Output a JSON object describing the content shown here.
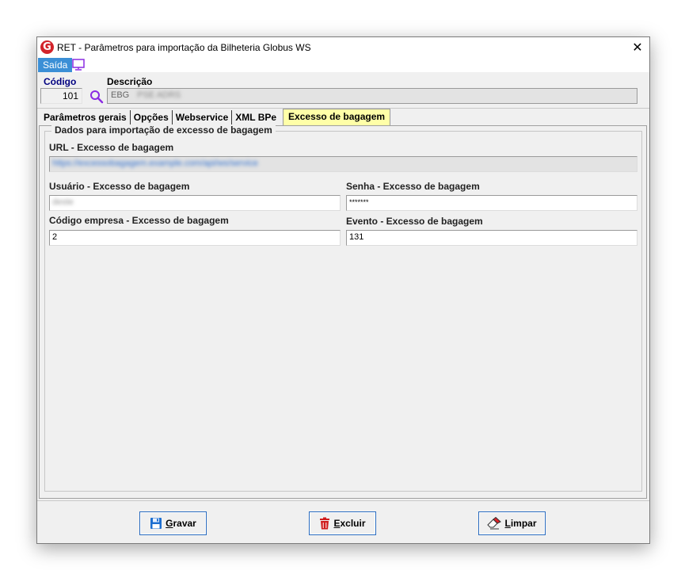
{
  "window": {
    "title": "RET - Parâmetros para importação da Bilheteria Globus WS",
    "logo_letter": "G",
    "close_glyph": "✕"
  },
  "menu": {
    "saida_label": "Saída"
  },
  "header": {
    "codigo_label": "Código",
    "codigo_value": "101",
    "descricao_label": "Descrição",
    "descricao_value": "EBG",
    "descricao_obscured": "PSE ADRS"
  },
  "tabs": [
    {
      "label": "Parâmetros gerais",
      "active": false
    },
    {
      "label": "Opções",
      "active": false
    },
    {
      "label": "Webservice",
      "active": false
    },
    {
      "label": "XML BPe",
      "active": false
    },
    {
      "label": "Excesso de bagagem",
      "active": true
    }
  ],
  "form": {
    "group_title": "Dados para importação de excesso de bagagem",
    "url_label": "URL - Excesso de bagagem",
    "url_value": "https://excessobagagem.example.com/api/ws/service",
    "usuario_label": "Usuário - Excesso de bagagem",
    "usuario_value": "deste",
    "senha_label": "Senha - Excesso de bagagem",
    "senha_value": "*******",
    "codigo_empresa_label": "Código empresa - Excesso de bagagem",
    "codigo_empresa_value": "2",
    "evento_label": "Evento - Excesso de bagagem",
    "evento_value": "131"
  },
  "buttons": {
    "gravar_first": "G",
    "gravar_rest": "ravar",
    "excluir_first": "E",
    "excluir_rest": "xcluir",
    "limpar_first": "L",
    "limpar_rest": "impar"
  },
  "icons": {
    "logo": "globus-logo-icon",
    "monitor": "monitor-icon",
    "search": "search-icon",
    "save": "floppy-disk-icon",
    "delete": "trash-icon",
    "clear": "eraser-icon"
  },
  "colors": {
    "accent": "#3b8fd6",
    "active_tab": "#ffffa8",
    "label_blue": "#000080",
    "logo_red": "#d2232a",
    "search_purple": "#8a2be2"
  }
}
